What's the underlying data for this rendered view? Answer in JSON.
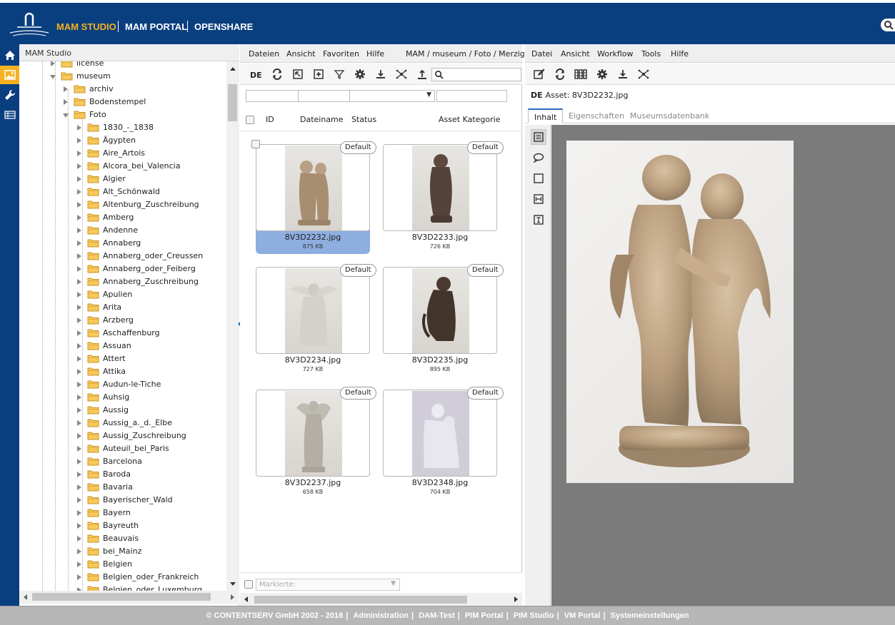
{
  "topnav": {
    "items": [
      "MAM STUDIO",
      "MAM PORTAL",
      "OPENSHARE"
    ]
  },
  "colors": {
    "brand_blue": "#0a3f7f",
    "accent_orange": "#f5b120",
    "selection_blue": "#8eaee0"
  },
  "rail": {
    "icons": [
      "home-icon",
      "image-icon",
      "wrench-icon",
      "table-icon"
    ]
  },
  "tree": {
    "header": "MAM Studio",
    "nodes": [
      {
        "label": "license",
        "state": "collapsed"
      },
      {
        "label": "museum",
        "state": "open"
      },
      {
        "label": "archiv",
        "state": "collapsed"
      },
      {
        "label": "Bodenstempel",
        "state": "collapsed"
      },
      {
        "label": "Foto",
        "state": "open"
      },
      {
        "label": "1830_-_1838"
      },
      {
        "label": "Ägypten"
      },
      {
        "label": "Aire_Artois"
      },
      {
        "label": "Alcora_bei_Valencia"
      },
      {
        "label": "Algier"
      },
      {
        "label": "Alt_Schönwald"
      },
      {
        "label": "Altenburg_Zuschreibung"
      },
      {
        "label": "Amberg"
      },
      {
        "label": "Andenne"
      },
      {
        "label": "Annaberg"
      },
      {
        "label": "Annaberg_oder_Creussen"
      },
      {
        "label": "Annaberg_oder_Feiberg"
      },
      {
        "label": "Annaberg_Zuschreibung"
      },
      {
        "label": "Apulien"
      },
      {
        "label": "Arita"
      },
      {
        "label": "Arzberg"
      },
      {
        "label": "Aschaffenburg"
      },
      {
        "label": "Assuan"
      },
      {
        "label": "Attert"
      },
      {
        "label": "Attika"
      },
      {
        "label": "Audun-le-Tiche"
      },
      {
        "label": "Auhsig"
      },
      {
        "label": "Aussig"
      },
      {
        "label": "Aussig_a._d._Elbe"
      },
      {
        "label": "Aussig_Zuschreibung"
      },
      {
        "label": "Auteuil_bei_Paris"
      },
      {
        "label": "Barcelona"
      },
      {
        "label": "Baroda"
      },
      {
        "label": "Bavaria"
      },
      {
        "label": "Bayerischer_Wald"
      },
      {
        "label": "Bayern"
      },
      {
        "label": "Bayreuth"
      },
      {
        "label": "Beauvais"
      },
      {
        "label": "bei_Mainz"
      },
      {
        "label": "Belgien"
      },
      {
        "label": "Belgien_oder_Frankreich"
      },
      {
        "label": "Belgien_oder_Luxemburg"
      }
    ]
  },
  "middle": {
    "menu": [
      "Dateien",
      "Ansicht",
      "Favoriten",
      "Hilfe"
    ],
    "breadcrumb": "MAM / museum / Foto / Merzig /",
    "lang": "DE",
    "toolbar_icons": [
      "refresh-icon",
      "select-area-icon",
      "add-icon",
      "filter-icon",
      "settings-icon",
      "upload-to-icon",
      "share-icon",
      "upload-icon",
      "search-icon"
    ],
    "columns": [
      "ID",
      "Dateiname",
      "Status",
      "Asset Kategorie"
    ],
    "badge": "Default",
    "tiles": [
      {
        "name": "8V3D2232.jpg",
        "size": "875 KB",
        "selected": true
      },
      {
        "name": "8V3D2233.jpg",
        "size": "726 KB",
        "selected": false
      },
      {
        "name": "8V3D2234.jpg",
        "size": "727 KB",
        "selected": false
      },
      {
        "name": "8V3D2235.jpg",
        "size": "895 KB",
        "selected": false
      },
      {
        "name": "8V3D2237.jpg",
        "size": "658 KB",
        "selected": false
      },
      {
        "name": "8V3D2348.jpg",
        "size": "704 KB",
        "selected": false
      }
    ],
    "marked_placeholder": "Markierte:"
  },
  "right": {
    "menu": [
      "Datei",
      "Ansicht",
      "Workflow",
      "Tools",
      "Hilfe"
    ],
    "toolbar_icons": [
      "edit-icon",
      "refresh-icon",
      "columns-icon",
      "settings-icon",
      "download-icon",
      "share-icon"
    ],
    "asset_lang": "DE",
    "asset_title": "Asset: 8V3D2232.jpg",
    "tabs": [
      "Inhalt",
      "Eigenschaften",
      "Museumsdatenbank"
    ],
    "active_tab": "Inhalt",
    "side_tools": [
      "document-icon",
      "comment-icon",
      "rectangle-icon",
      "width-icon",
      "text-icon"
    ]
  },
  "footer": {
    "copyright": "© CONTENTSERV GmbH 2002 - 2018",
    "links": [
      "Administration",
      "DAM-Test",
      "PIM Portal",
      "PIM Studio",
      "VM Portal",
      "Systemeinstellungen"
    ]
  }
}
